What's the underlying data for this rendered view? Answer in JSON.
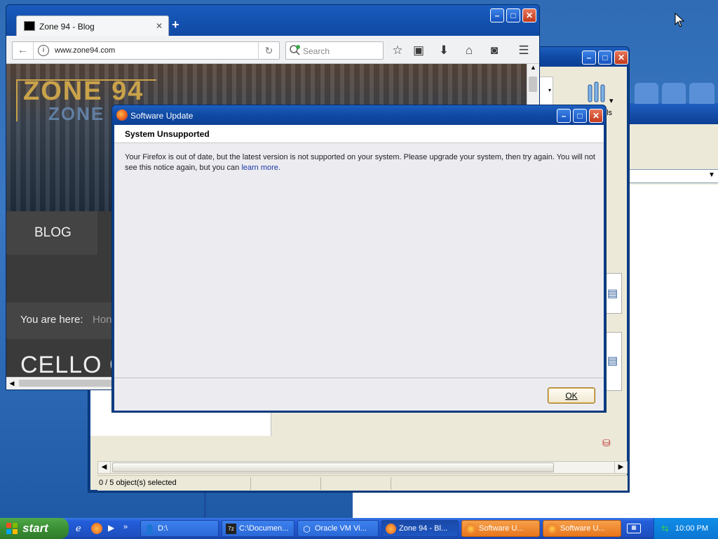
{
  "colors": {
    "desktop": "#3a6ea5",
    "title_blue": "#0f4aa4",
    "taskbar": "#245edb",
    "flash_orange": "#e8761c",
    "site_dark": "#3c3c3c",
    "accent_gold": "#c9a24a"
  },
  "firefox": {
    "tab_title": "Zone 94 - Blog",
    "new_tab": "+",
    "url": "www.zone94.com",
    "search_placeholder": "Search",
    "site": {
      "logo": "ZONE 94",
      "logo_echo": "ZONE 9",
      "nav_blog": "BLOG",
      "breadcrumb_label": "You are here:",
      "breadcrumb_link": "Hon",
      "article_title": "CELLO CR"
    }
  },
  "explorer": {
    "toolbar_label": "ols",
    "status_text": "0 / 5 object(s) selected"
  },
  "dialog": {
    "title": "Software Update",
    "heading": "System Unsupported",
    "message": "Your Firefox is out of date, but the latest version is not supported on your system. Please upgrade your system, then try again. You will not see this notice again, but you can ",
    "link": "learn more.",
    "ok": "OK"
  },
  "taskbar": {
    "start": "start",
    "tasks": [
      {
        "label": "D:\\",
        "icon": "user-icon"
      },
      {
        "label": "C:\\Documen...",
        "icon": "7zip-icon"
      },
      {
        "label": "Oracle VM Vi...",
        "icon": "virtualbox-icon"
      },
      {
        "label": "Zone 94 - Bl...",
        "icon": "firefox-icon"
      },
      {
        "label": "Software U...",
        "icon": "firefox-icon"
      },
      {
        "label": "Software U...",
        "icon": "firefox-icon"
      }
    ],
    "clock": "10:00 PM"
  }
}
